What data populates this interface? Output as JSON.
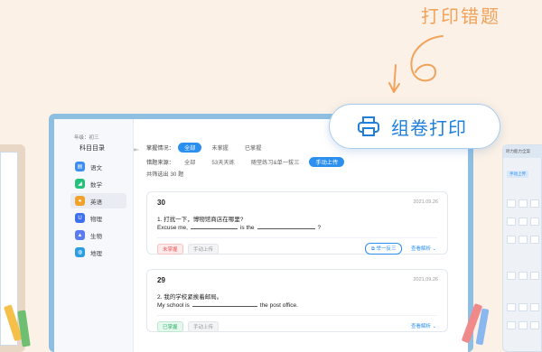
{
  "headline": "打印错题",
  "print_button": {
    "label": "组卷打印",
    "icon": "printer-icon"
  },
  "sidebar": {
    "grade": "年级：初三",
    "title": "科目目录",
    "items": [
      {
        "label": "语文",
        "icon": "book-icon",
        "color": "#3d8ef0",
        "active": false
      },
      {
        "label": "数学",
        "icon": "ruler-icon",
        "color": "#25c07a",
        "active": false
      },
      {
        "label": "英语",
        "icon": "people-icon",
        "color": "#f1a22a",
        "active": true
      },
      {
        "label": "物理",
        "icon": "magnet-icon",
        "color": "#3d6ff0",
        "active": false
      },
      {
        "label": "生物",
        "icon": "flask-icon",
        "color": "#5a7cf0",
        "active": false
      },
      {
        "label": "地理",
        "icon": "globe-icon",
        "color": "#2b9de0",
        "active": false
      }
    ]
  },
  "filters": {
    "mastery_label": "掌握情况：",
    "mastery_options": [
      "全部",
      "未掌握",
      "已掌握"
    ],
    "mastery_selected": 0,
    "source_label": "错题来源：",
    "source_options": [
      "全部",
      "53天天练",
      "随堂练习&单一拔三",
      "手动上传"
    ],
    "source_selected": 3,
    "count_text": "共筛选出 30 题"
  },
  "cards": [
    {
      "number": "30",
      "date": "2021.09.26",
      "question": "1. 打扰一下，博物馆商店在哪里?",
      "answer_prefix": "Excuse me,",
      "answer_mid": "is the",
      "answer_end": "?",
      "status_tag": "未掌握",
      "status_color": "red",
      "source_tag": "手动上传",
      "similar_label": "举一反三",
      "analysis_label": "查看解析 ⌄"
    },
    {
      "number": "29",
      "date": "2021.09.26",
      "question": "2. 我的学校紧挨着邮局。",
      "answer_prefix": "My school is",
      "answer_end": "the post office.",
      "status_tag": "已掌握",
      "status_color": "green",
      "source_tag": "手动上传",
      "analysis_label": "查看解析 ⌄"
    }
  ],
  "right_panel": {
    "title": "听力能力全案",
    "button": "手动上传"
  }
}
